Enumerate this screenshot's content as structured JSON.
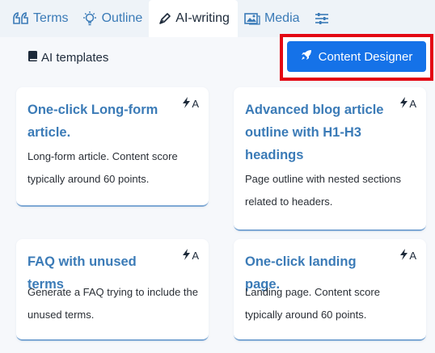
{
  "tabs": [
    {
      "label": "Terms",
      "icon": "terms-icon"
    },
    {
      "label": "Outline",
      "icon": "lightbulb-icon"
    },
    {
      "label": "AI-writing",
      "icon": "pen-icon"
    },
    {
      "label": "Media",
      "icon": "media-icon"
    },
    {
      "label": "",
      "icon": "sliders-icon"
    }
  ],
  "active_tab": "AI-writing",
  "section": {
    "label": "AI templates",
    "icon": "book-icon"
  },
  "content_designer": {
    "label": "Content Designer",
    "icon": "rocket-icon"
  },
  "cards": [
    {
      "title": "One-click Long-form article.",
      "description": "Long-form article. Content score typically around 60 points.",
      "badge": "A"
    },
    {
      "title": "Advanced blog article outline with H1-H3 headings",
      "description": "Page outline with nested sections related to headers.",
      "badge": "A"
    },
    {
      "title": "FAQ with unused terms",
      "description": "Generate a FAQ trying to include the unused terms.",
      "badge": "A"
    },
    {
      "title": "One-click landing page.",
      "description": "Landing page. Content score typically around 60 points.",
      "badge": "A"
    }
  ],
  "colors": {
    "accent": "#1572e8",
    "link": "#3b7bb7",
    "highlight": "#e30613"
  }
}
